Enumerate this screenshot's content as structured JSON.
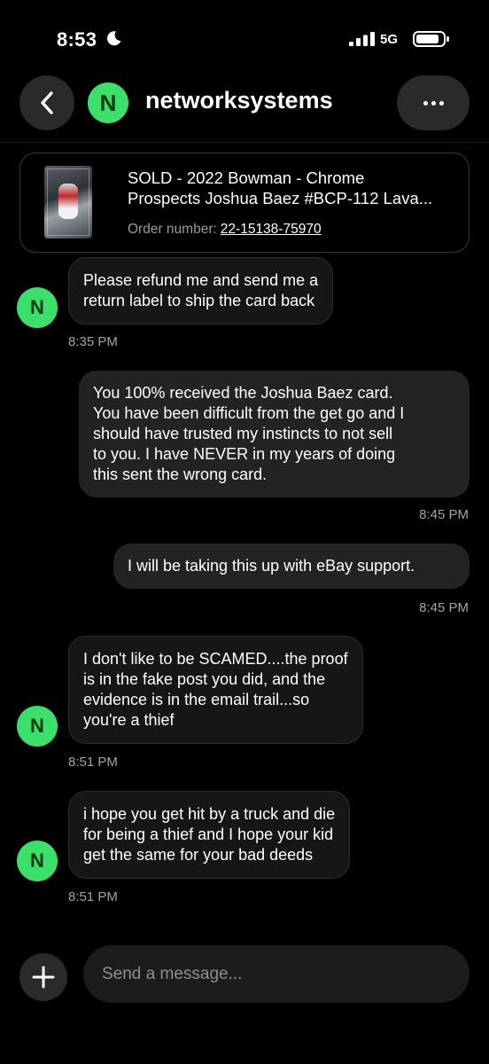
{
  "status_bar": {
    "time": "8:53",
    "network": "5G"
  },
  "header": {
    "avatar_letter": "N",
    "contact_name": "networksystems"
  },
  "order": {
    "title_line1": "SOLD - 2022 Bowman - Chrome",
    "title_line2": "Prospects Joshua Baez #BCP-112 Lava...",
    "order_label": "Order number:",
    "order_number": "22-15138-75970"
  },
  "messages": [
    {
      "direction": "in",
      "avatar": "N",
      "lines": [
        "Please refund me and send me a",
        "return label to ship the card back"
      ],
      "time": "8:35 PM"
    },
    {
      "direction": "out",
      "lines": [
        "You 100% received the Joshua Baez card.",
        "You have been difficult from the get go and I",
        "should have trusted my instincts to not sell",
        "to you. I have NEVER in my years of doing",
        "this sent the wrong card."
      ],
      "time": "8:45 PM"
    },
    {
      "direction": "out",
      "lines": [
        "I will be taking this up with eBay support."
      ],
      "time": "8:45 PM"
    },
    {
      "direction": "in",
      "avatar": "N",
      "lines": [
        "I don't like to be SCAMED....the proof",
        "is in the fake post you did, and the",
        "evidence is in the email trail...so",
        "you're a thief"
      ],
      "time": "8:51 PM"
    },
    {
      "direction": "in",
      "avatar": "N",
      "lines": [
        "i hope you get hit by a truck and die",
        "for being a thief and I hope your kid",
        "get the same for your bad deeds"
      ],
      "time": "8:51 PM"
    }
  ],
  "composer": {
    "placeholder": "Send a message..."
  },
  "colors": {
    "accent_green": "#3be06a",
    "background": "#000000",
    "bubble_out": "#232325"
  }
}
